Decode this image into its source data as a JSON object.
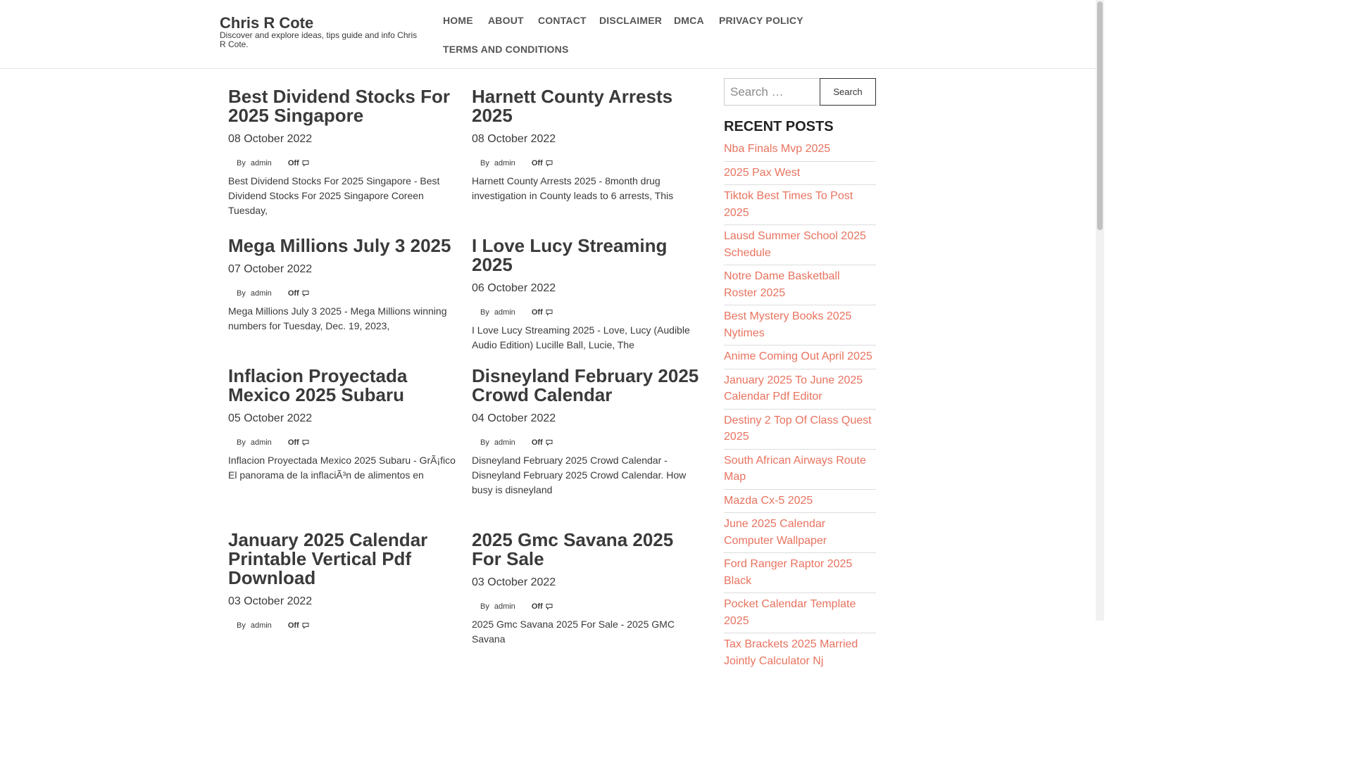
{
  "site": {
    "title": "Chris R Cote",
    "description": "Discover and explore ideas, tips guide and info Chris R Cote."
  },
  "nav": {
    "items": [
      "HOME",
      "ABOUT",
      "CONTACT",
      "DISCLAIMER",
      "DMCA",
      "PRIVACY POLICY",
      "TERMS AND CONDITIONS"
    ]
  },
  "posts": [
    {
      "title": "Best Dividend Stocks For 2025 Singapore",
      "date": "08 October 2022",
      "by": "By",
      "author": "admin",
      "comments": "Off",
      "excerpt": "Best Dividend Stocks For 2025 Singapore - Best Dividend Stocks For 2025 Singapore Coreen Tuesday,"
    },
    {
      "title": "Harnett County Arrests 2025",
      "date": "08 October 2022",
      "by": "By",
      "author": "admin",
      "comments": "Off",
      "excerpt": "Harnett County Arrests 2025 - 8month drug investigation in County leads to 6 arrests, This"
    },
    {
      "title": "Mega Millions July 3 2025",
      "date": "07 October 2022",
      "by": "By",
      "author": "admin",
      "comments": "Off",
      "excerpt": "Mega Millions July 3 2025 - Mega Millions winning numbers for Tuesday, Dec. 19, 2023,"
    },
    {
      "title": "I Love Lucy Streaming 2025",
      "date": "06 October 2022",
      "by": "By",
      "author": "admin",
      "comments": "Off",
      "excerpt": "I Love Lucy Streaming 2025 - Love, Lucy (Audible Audio Edition) Lucille Ball, Lucie, The"
    },
    {
      "title": "Inflacion Proyectada Mexico 2025 Subaru",
      "date": "05 October 2022",
      "by": "By",
      "author": "admin",
      "comments": "Off",
      "excerpt": "Inflacion Proyectada Mexico 2025 Subaru - GrÃ¡fico El panorama de la inflaciÃ³n de alimentos en"
    },
    {
      "title": "Disneyland February 2025 Crowd Calendar",
      "date": "04 October 2022",
      "by": "By",
      "author": "admin",
      "comments": "Off",
      "excerpt": "Disneyland February 2025 Crowd Calendar - Disneyland February 2025 Crowd Calendar. How busy is disneyland"
    },
    {
      "title": "January 2025 Calendar Printable Vertical Pdf Download",
      "date": "03 October 2022",
      "by": "By",
      "author": "admin",
      "comments": "Off",
      "excerpt": ""
    },
    {
      "title": "2025 Gmc Savana 2025 For Sale",
      "date": "03 October 2022",
      "by": "By",
      "author": "admin",
      "comments": "Off",
      "excerpt": "2025 Gmc Savana 2025 For Sale - 2025 GMC Savana"
    }
  ],
  "sidebar": {
    "search_placeholder": "Search …",
    "search_button": "Search",
    "recent_heading": "RECENT POSTS",
    "recent_posts": [
      "Nba Finals Mvp 2025",
      "2025 Pax West",
      "Tiktok Best Times To Post 2025",
      "Lausd Summer School 2025 Schedule",
      "Notre Dame Basketball Roster 2025",
      "Best Mystery Books 2025 Nytimes",
      "Anime Coming Out April 2025",
      "January 2025 To June 2025 Calendar Pdf Editor",
      "Destiny 2 Top Of Class Quest 2025",
      "South African Airways Route Map",
      "Mazda Cx-5 2025",
      "June 2025 Calendar Computer Wallpaper",
      "Ford Ranger Raptor 2025 Black",
      "Pocket Calendar Template 2025",
      "Tax Brackets 2025 Married Jointly Calculator Nj"
    ]
  },
  "colors": {
    "link_accent": "#e8735f",
    "text": "#3a3a3a"
  }
}
